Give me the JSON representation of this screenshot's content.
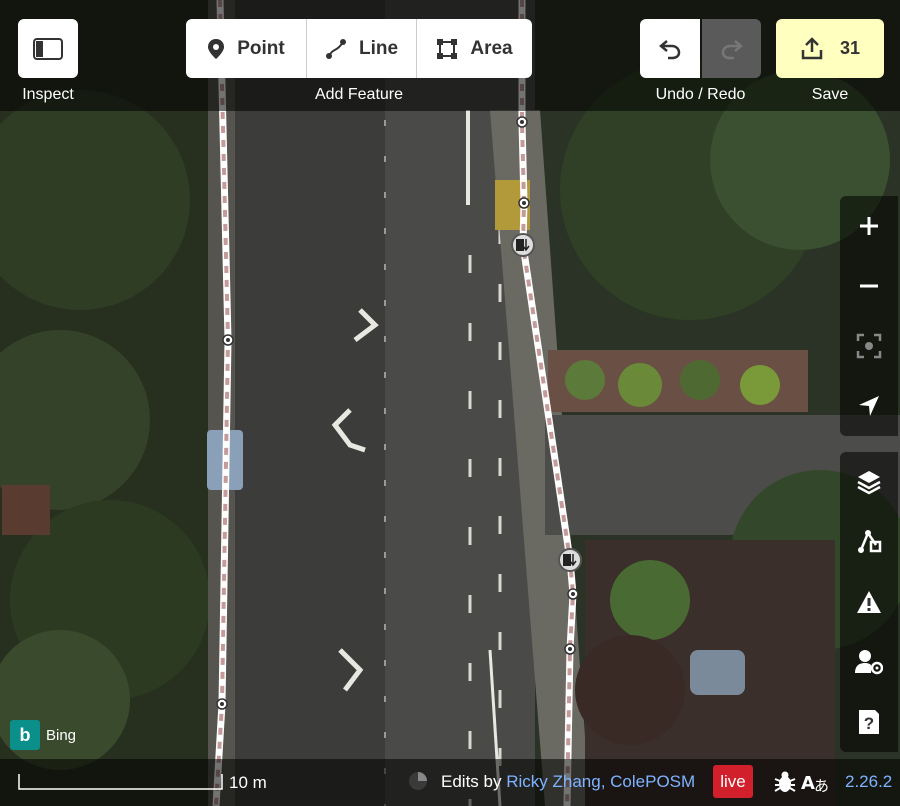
{
  "toolbar": {
    "inspect_label": "Inspect",
    "add_feature_label": "Add Feature",
    "point_label": "Point",
    "line_label": "Line",
    "area_label": "Area",
    "undo_redo_label": "Undo / Redo",
    "save_label": "Save",
    "save_count": "31"
  },
  "map_controls": [
    "zoom-in",
    "zoom-out",
    "zoom-to-selection",
    "geolocate"
  ],
  "panel_controls": [
    "background-layers",
    "map-data",
    "issues",
    "preferences",
    "help"
  ],
  "footer": {
    "imagery_provider": "Bing",
    "scale_label": "10 m",
    "edits_prefix": "Edits by",
    "edits_users": "Ricky Zhang, ColePOSM",
    "live_badge": "live",
    "version": "2.26.2"
  },
  "colors": {
    "save_bg": "#ffffc0",
    "live_badge": "#d11f2b",
    "link": "#7fb3ff",
    "sidewalk_dash": "#c49a9a",
    "bing": "#0a8f8a"
  }
}
